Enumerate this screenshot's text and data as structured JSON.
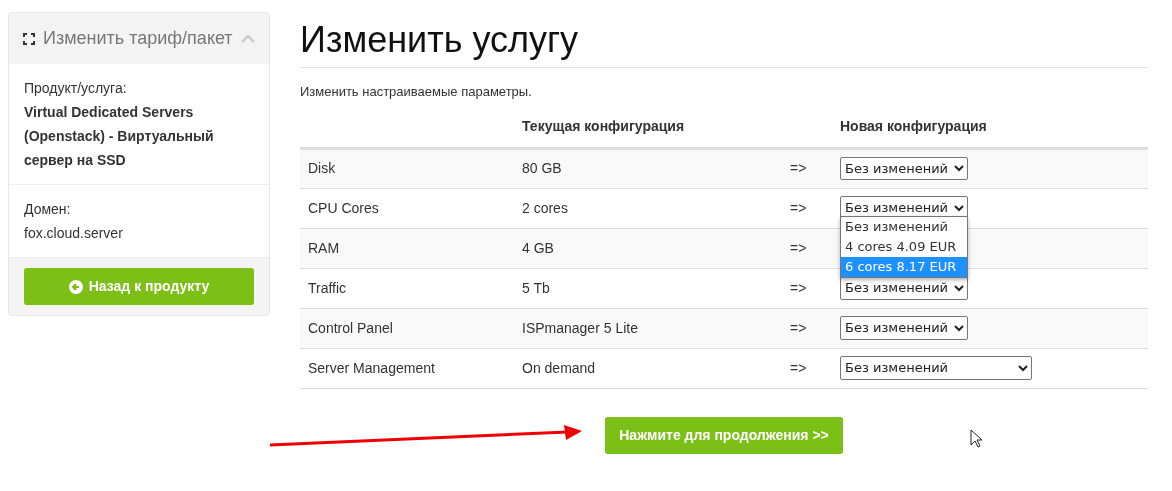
{
  "sidebar": {
    "title": "Изменить тариф/пакет",
    "expanded": true,
    "product_label": "Продукт/услуга:",
    "product_name": "Virtual Dedicated Servers (Openstack) - Виртуальный сервер на SSD",
    "domain_label": "Домен:",
    "domain": "fox.cloud.server",
    "back_button": "Назад к продукту"
  },
  "heading": "Изменить услугу",
  "intro": "Изменить настраиваемые параметры.",
  "table": {
    "columns": [
      "Текущая конфигурация",
      "Новая конфигурация"
    ],
    "rows": [
      {
        "name": "Disk",
        "current": "80 GB",
        "arrow": "=>",
        "select": "Без изменений"
      },
      {
        "name": "CPU Cores",
        "current": "2 cores",
        "arrow": "=>",
        "select": "Без изменений",
        "open": true,
        "options": [
          {
            "label": "Без изменений",
            "selected": false
          },
          {
            "label": "4 cores 4.09 EUR",
            "selected": false
          },
          {
            "label": "6 cores 8.17 EUR",
            "selected": true
          }
        ]
      },
      {
        "name": "RAM",
        "current": "4 GB",
        "arrow": "=>"
      },
      {
        "name": "Traffic",
        "current": "5 Tb",
        "arrow": "=>",
        "select": "Без изменений"
      },
      {
        "name": "Control Panel",
        "current": "ISPmanager 5 Lite",
        "arrow": "=>",
        "select": "Без изменений"
      },
      {
        "name": "Server Management",
        "current": "On demand",
        "arrow": "=>",
        "select": "Без изменений",
        "wide": true
      }
    ]
  },
  "continue_button": "Нажмите для продолжения >>"
}
